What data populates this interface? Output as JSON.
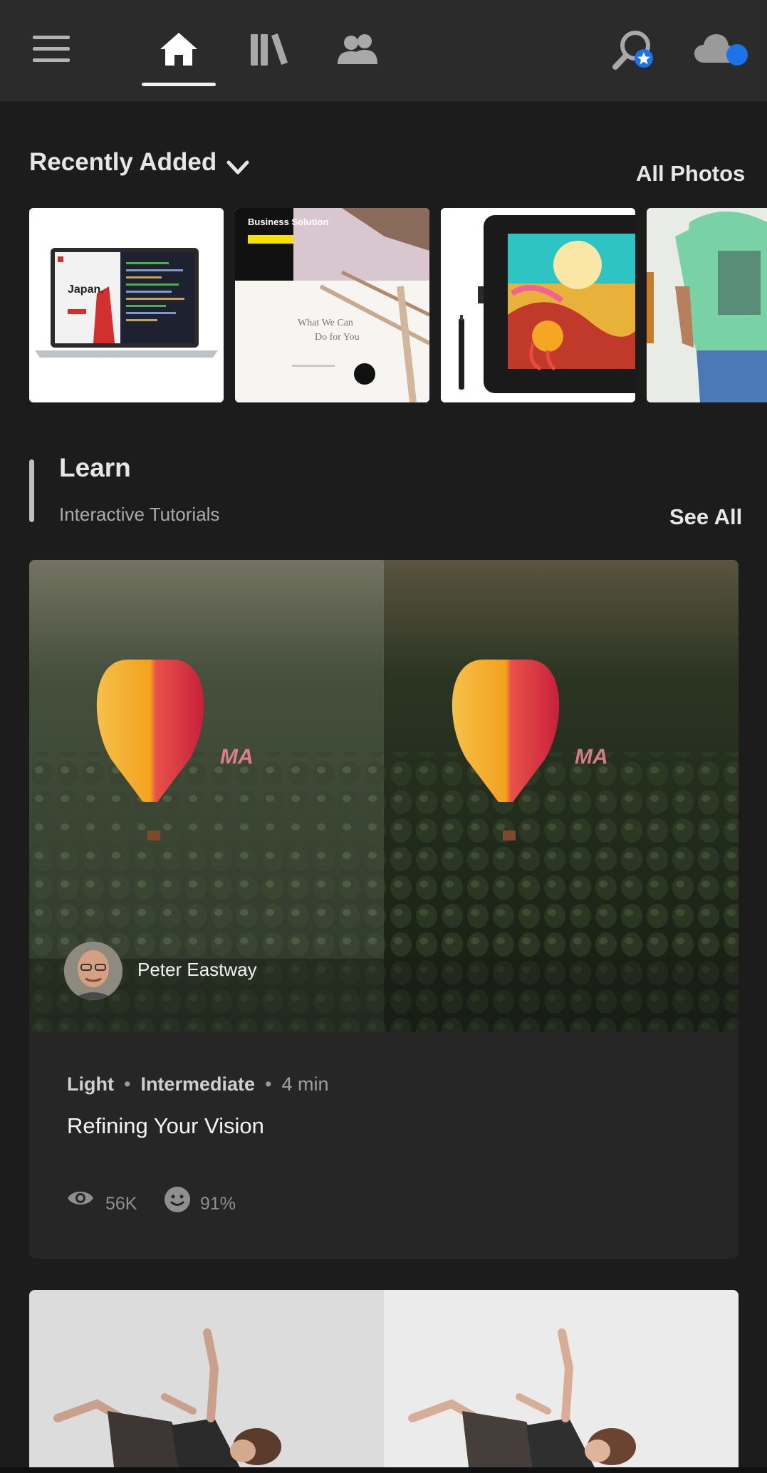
{
  "nav": {
    "menu_icon": "hamburger-icon",
    "tabs": [
      {
        "icon": "home-icon",
        "active": true
      },
      {
        "icon": "library-icon",
        "active": false
      },
      {
        "icon": "people-icon",
        "active": false
      }
    ],
    "search_icon": "search-icon",
    "cloud_icon": "cloud-sync-icon",
    "accent": "#1a73e8"
  },
  "recent": {
    "title": "Recently Added",
    "link": "All Photos",
    "thumb_text": {
      "laptop_heading": "Japan.",
      "web_banner": "Business Solution",
      "web_line1": "What We Can",
      "web_line2": "Do for You"
    }
  },
  "learn": {
    "title": "Learn",
    "subtitle": "Interactive Tutorials",
    "link": "See All"
  },
  "tutorial": {
    "author": "Peter Eastway",
    "category": "Light",
    "level": "Intermediate",
    "duration": "4 min",
    "title": "Refining Your Vision",
    "views": "56K",
    "rating": "91%",
    "balloon_text": "MA"
  }
}
